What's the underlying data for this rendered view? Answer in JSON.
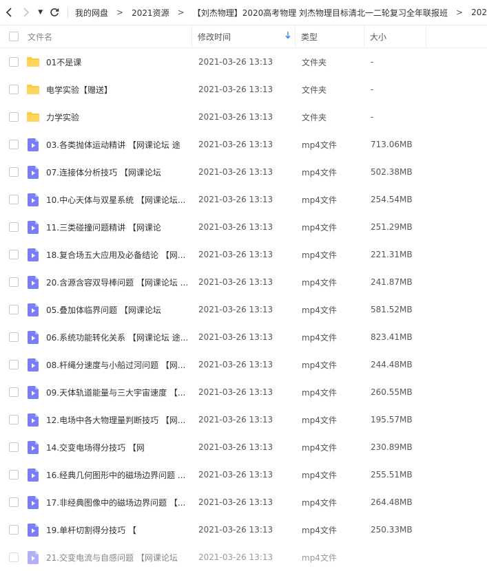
{
  "toolbar": {
    "breadcrumbs": [
      "我的网盘",
      "2021资源",
      "【刘杰物理】2020高考物理 刘杰物理目标清北一二轮复习全年联报班",
      "202"
    ],
    "crumb_sep": ">"
  },
  "columns": {
    "name": "文件名",
    "time": "修改时间",
    "type": "类型",
    "size": "大小"
  },
  "rows": [
    {
      "name": "01不是课",
      "time": "2021-03-26 13:13",
      "type": "文件夹",
      "size": "-",
      "icon": "folder-icon"
    },
    {
      "name": "电学实验【赠送】",
      "time": "2021-03-26 13:13",
      "type": "文件夹",
      "size": "-",
      "icon": "folder-icon"
    },
    {
      "name": "力学实验",
      "time": "2021-03-26 13:13",
      "type": "文件夹",
      "size": "-",
      "icon": "folder-icon"
    },
    {
      "name": "03.各类抛体运动精讲 【网课论坛 途",
      "time": "2021-03-26 13:13",
      "type": "mp4文件",
      "size": "713.06MB",
      "icon": "video-icon"
    },
    {
      "name": "07.连接体分析技巧 【网课论坛",
      "time": "2021-03-26 13:13",
      "type": "mp4文件",
      "size": "502.38MB",
      "icon": "video-icon"
    },
    {
      "name": "10.中心天体与双星系统 【网课论坛...",
      "time": "2021-03-26 13:13",
      "type": "mp4文件",
      "size": "254.54MB",
      "icon": "video-icon"
    },
    {
      "name": "11.三类碰撞问题精讲 【网课论",
      "time": "2021-03-26 13:13",
      "type": "mp4文件",
      "size": "251.29MB",
      "icon": "video-icon"
    },
    {
      "name": "18.复合场五大应用及必备结论 【网...",
      "time": "2021-03-26 13:13",
      "type": "mp4文件",
      "size": "221.31MB",
      "icon": "video-icon"
    },
    {
      "name": "20.含源含容双导棒问题 【网课论坛 ...",
      "time": "2021-03-26 13:13",
      "type": "mp4文件",
      "size": "241.87MB",
      "icon": "video-icon"
    },
    {
      "name": "05.叠加体临界问题 【网课论坛",
      "time": "2021-03-26 13:13",
      "type": "mp4文件",
      "size": "581.52MB",
      "icon": "video-icon"
    },
    {
      "name": "06.系统功能转化关系 【网课论坛 途...",
      "time": "2021-03-26 13:13",
      "type": "mp4文件",
      "size": "823.41MB",
      "icon": "video-icon"
    },
    {
      "name": "08.杆绳分速度与小船过河问题 【网...",
      "time": "2021-03-26 13:13",
      "type": "mp4文件",
      "size": "244.48MB",
      "icon": "video-icon"
    },
    {
      "name": "09.天体轨道能量与三大宇宙速度 【...",
      "time": "2021-03-26 13:13",
      "type": "mp4文件",
      "size": "260.55MB",
      "icon": "video-icon"
    },
    {
      "name": "12.电场中各大物理量判断技巧 【网...",
      "time": "2021-03-26 13:13",
      "type": "mp4文件",
      "size": "195.57MB",
      "icon": "video-icon"
    },
    {
      "name": "14.交变电场得分技巧 【网",
      "time": "2021-03-26 13:13",
      "type": "mp4文件",
      "size": "230.89MB",
      "icon": "video-icon"
    },
    {
      "name": "16.经典几何图形中的磁场边界问题 ...",
      "time": "2021-03-26 13:13",
      "type": "mp4文件",
      "size": "255.51MB",
      "icon": "video-icon"
    },
    {
      "name": "17.非经典图像中的磁场边界问题 【...",
      "time": "2021-03-26 13:13",
      "type": "mp4文件",
      "size": "264.48MB",
      "icon": "video-icon"
    },
    {
      "name": "19.单杆切割得分技巧 【",
      "time": "2021-03-26 13:13",
      "type": "mp4文件",
      "size": "250.33MB",
      "icon": "video-icon"
    },
    {
      "name": "21.交变电流与自感问题 【网课论坛",
      "time": "2021-03-26 13:13",
      "type": "mp4文件",
      "size": "",
      "icon": "video-icon"
    }
  ],
  "colors": {
    "folder": "#ffc83d",
    "video": "#7b7cf6",
    "sort_arrow": "#2d8cf0"
  }
}
